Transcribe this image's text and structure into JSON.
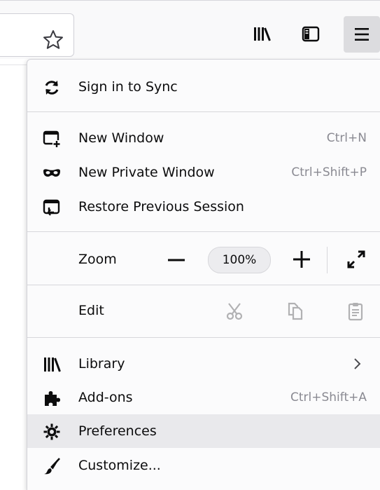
{
  "menu": {
    "sync_label": "Sign in to Sync",
    "new_window": {
      "label": "New Window",
      "shortcut": "Ctrl+N"
    },
    "new_private_window": {
      "label": "New Private Window",
      "shortcut": "Ctrl+Shift+P"
    },
    "restore_session": {
      "label": "Restore Previous Session"
    },
    "zoom": {
      "label": "Zoom",
      "value": "100%",
      "minus": "−",
      "plus": "+"
    },
    "edit": {
      "label": "Edit"
    },
    "library": {
      "label": "Library"
    },
    "addons": {
      "label": "Add-ons",
      "shortcut": "Ctrl+Shift+A"
    },
    "preferences": {
      "label": "Preferences",
      "hovered": true
    },
    "customize": {
      "label": "Customize..."
    }
  },
  "toolbar": {
    "icons": [
      "star-icon",
      "library-icon",
      "sidebar-icon",
      "hamburger-menu-icon"
    ]
  },
  "colors": {
    "hover_bg": "#e9e9ec",
    "shortcut_text": "#8a8a92",
    "icon": "#0c0c0d",
    "disabled_icon": "#b1b1b3"
  }
}
